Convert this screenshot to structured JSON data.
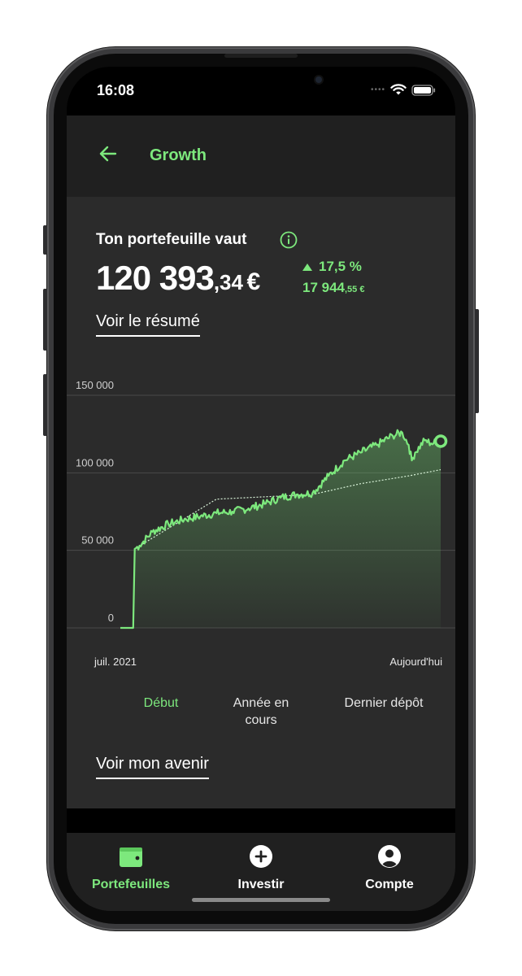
{
  "status": {
    "time": "16:08"
  },
  "header": {
    "title": "Growth"
  },
  "portfolio": {
    "label": "Ton portefeuille vaut",
    "value_int": "120 393",
    "value_dec": ",34",
    "currency": "€",
    "gain_pct": "17,5 %",
    "gain_abs_int": "17 944",
    "gain_abs_dec": ",55 €"
  },
  "links": {
    "summary": "Voir le résumé",
    "future": "Voir mon avenir"
  },
  "chart_data": {
    "type": "area",
    "x_start_label": "juil. 2021",
    "x_end_label": "Aujourd'hui",
    "ylim": [
      0,
      150000
    ],
    "yticks": [
      "150 000",
      "100 000",
      "50 000",
      "0"
    ],
    "series": [
      {
        "x": [
          0,
          0.04,
          0.045,
          0.06,
          0.1,
          0.15,
          0.2,
          0.25,
          0.3,
          0.35,
          0.4,
          0.45,
          0.5,
          0.55,
          0.6,
          0.65,
          0.7,
          0.75,
          0.8,
          0.85,
          0.88,
          0.9,
          0.91,
          0.92,
          0.95,
          0.97,
          1.0
        ],
        "values": [
          0,
          0,
          51000,
          53000,
          62000,
          67000,
          70000,
          72000,
          74000,
          75000,
          77000,
          80000,
          84000,
          86000,
          87000,
          98000,
          108000,
          113000,
          118000,
          124000,
          126000,
          118000,
          108000,
          113000,
          121000,
          119000,
          120393
        ]
      },
      {
        "x": [
          0,
          0.04,
          0.045,
          0.3,
          0.6,
          0.75,
          0.9,
          1.0
        ],
        "values": [
          0,
          0,
          51000,
          83000,
          86000,
          93000,
          98000,
          102000
        ]
      }
    ],
    "grid": true,
    "colors": {
      "line": "#7de87d",
      "deposit": "#d8f2d8",
      "grid": "#4a4a4a"
    }
  },
  "ranges": [
    {
      "label": "Début",
      "active": true
    },
    {
      "label": "Année en cours",
      "active": false
    },
    {
      "label": "Dernier dépôt",
      "active": false
    }
  ],
  "nav": [
    {
      "label": "Portefeuilles",
      "icon": "wallet-icon",
      "active": true
    },
    {
      "label": "Investir",
      "icon": "plus-circle-icon",
      "active": false
    },
    {
      "label": "Compte",
      "icon": "user-circle-icon",
      "active": false
    }
  ],
  "colors": {
    "accent": "#7de87d",
    "background": "#2b2b2b",
    "header": "#202020"
  }
}
